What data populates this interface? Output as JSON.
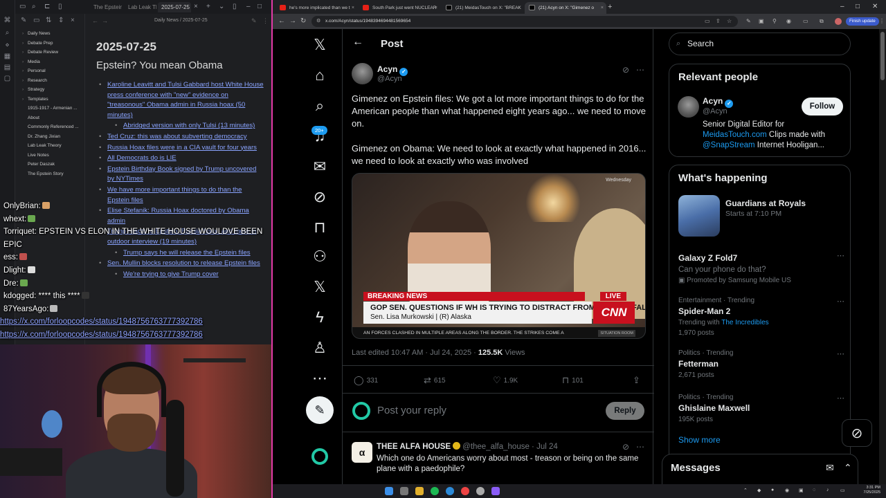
{
  "obsidian": {
    "tabs": [
      "The Epstein ...",
      "Lab Leak Th...",
      "2025-07-25"
    ],
    "breadcrumb": "Daily News  /  2025-07-25",
    "tree": [
      {
        "label": "Daily News",
        "top": true
      },
      {
        "label": "Debate Prep",
        "top": true
      },
      {
        "label": "Debate Review",
        "top": true
      },
      {
        "label": "Media",
        "top": true
      },
      {
        "label": "Personal",
        "top": true
      },
      {
        "label": "Research",
        "top": true
      },
      {
        "label": "Strategy",
        "top": true
      },
      {
        "label": "Templates",
        "top": true
      },
      {
        "label": "1915-1917 - Armenian ...",
        "top": false
      },
      {
        "label": "About",
        "top": false
      },
      {
        "label": "Commonly Referenced ...",
        "top": false
      },
      {
        "label": "Dr. Zhang Jixian",
        "top": false
      },
      {
        "label": "Lab Leak Theory",
        "top": false
      },
      {
        "label": "Live Notes",
        "top": false
      },
      {
        "label": "Peter Daszak",
        "top": false
      },
      {
        "label": "The Epstein Story",
        "top": false
      }
    ],
    "date_heading": "2025-07-25",
    "section_heading": "Epstein? You mean Obama",
    "notes": [
      {
        "text": "Karoline Leavitt and Tulsi Gabbard host White House press conference with \"new\" evidence on \"treasonous\" Obama admin in Russia hoax (50 minutes)",
        "level": 1
      },
      {
        "text": "Abridged version with only Tulsi (13 minutes)",
        "level": 2
      },
      {
        "text": "Ted Cruz: this was about subverting democracy",
        "level": 1
      },
      {
        "text": "Russia Hoax files were in a CIA vault for four years",
        "level": 1
      },
      {
        "text": "All Democrats do is LIE",
        "level": 1
      },
      {
        "text": "Epstein Birthday Book signed by Trump uncovered by NYTimes",
        "level": 1
      },
      {
        "text": "We have more important things to do than the Epstein files",
        "level": 1
      },
      {
        "text": "Elise Stefanik: Russia Hoax doctored by Obama admin",
        "level": 1
      },
      {
        "text": "Trump reacts to Epstein, Russia hoax, and more in outdoor interview (19 minutes)",
        "level": 1
      },
      {
        "text": "Trump says he will release the Epstein files",
        "level": 2
      },
      {
        "text": "Sen. Mullin blocks resolution to release Epstein files",
        "level": 1
      },
      {
        "text": "We're trying to give Trump cover",
        "level": 2
      }
    ]
  },
  "chat": [
    {
      "user": "OnlyBrian:",
      "text": "",
      "emote_color": "#d9a066"
    },
    {
      "user": "whext:",
      "text": "",
      "emote_color": "#6aa84f"
    },
    {
      "user": "Torriquet:",
      "text": "EPSTEIN VS ELON IN THE WHITE HOUSE WOULDVE BEEN",
      "emote_color": ""
    },
    {
      "user": "EPIC",
      "text": "",
      "emote_color": ""
    },
    {
      "user": "ess:",
      "text": "",
      "emote_color": "#c0504d"
    },
    {
      "user": "Dlight:",
      "text": "",
      "emote_color": "#dddddd"
    },
    {
      "user": "Dre:",
      "text": "",
      "emote_color": "#6aa84f"
    },
    {
      "user": "kdogged:",
      "text": "**** this ****",
      "emote_color": "#333333"
    },
    {
      "user": "87YearsAgo:",
      "text": "",
      "emote_color": "#bbbbbb"
    }
  ],
  "chat_urls": [
    "https://x.com/forloopcodes/status/1948756763777392786",
    "https://x.com/forloopcodes/status/1948756763777392786"
  ],
  "chrome": {
    "tabs": [
      {
        "title": "he's more implicated than we t",
        "color": "#e62117",
        "active": false
      },
      {
        "title": "South Park just went NUCLEAR",
        "color": "#e62117",
        "active": false
      },
      {
        "title": "(21) MeidasTouch on X: \"BREAK",
        "color": "#000000",
        "active": false
      },
      {
        "title": "(21) Acyn on X: \"Gimenez o",
        "color": "#000000",
        "active": true
      }
    ],
    "url": "x.com/Acyn/status/1948394694481569654",
    "finish_update": "Finish update"
  },
  "x": {
    "badge": "20+",
    "compose_icon": "feather-plus-icon",
    "post_title": "Post",
    "author_name": "Acyn",
    "author_handle": "@Acyn",
    "post_text_1": "Gimenez on Epstein files: We got a lot more important things to do for the American people than what happened eight years ago... we need to move on.",
    "post_text_2": "Gimenez on Obama: We need to look at exactly what happened in 2016... we need to look at exactly who was involved",
    "video": {
      "day": "Wednesday",
      "breaking": "BREAKING NEWS",
      "live": "LIVE",
      "headline": "GOP SEN. QUESTIONS IF WH IS TRYING TO DISTRACT FROM EPSTEIN FALLOUT",
      "subline": "Sen. Lisa Murkowski  |  (R) Alaska",
      "network": "CNN",
      "ticker": "AN FORCES CLASHED IN MULTIPLE AREAS ALONG THE BORDER. THE STRIKES COME A",
      "situation": "SITUATION ROOM"
    },
    "edited": "Last edited 10:47 AM · Jul 24, 2025 · ",
    "views_count": "125.5K",
    "views_label": " Views",
    "actions": {
      "replies": "331",
      "reposts": "615",
      "likes": "1.9K",
      "bookmarks": "101"
    },
    "reply_placeholder": "Post your reply",
    "reply_button": "Reply",
    "tweet2": {
      "name": "THEE ALFA HOUSE",
      "meta": "@thee_alfa_house · Jul 24",
      "avatar_text": "α",
      "text": "Which one do Americans worry about most - treason or being on the same plane with a paedophile?"
    },
    "search_placeholder": "Search",
    "relevant_title": "Relevant people",
    "rp": {
      "name": "Acyn",
      "handle": "@Acyn",
      "follow": "Follow",
      "bio_1": "Senior Digital Editor for ",
      "bio_link1": "MeidasTouch.com",
      "bio_2": " Clips made with ",
      "bio_link2": "@SnapStream",
      "bio_3": " Internet Hooligan..."
    },
    "happening_title": "What's happening",
    "game": {
      "title": "Guardians at Royals",
      "sub": "Starts at 7:10 PM"
    },
    "promo": {
      "name": "Galaxy Z Fold7",
      "sub": "Can your phone do that?",
      "promoted": "Promoted by Samsung Mobile US"
    },
    "trends": [
      {
        "context": "Entertainment · Trending",
        "name": "Spider-Man 2",
        "count_prefix": "Trending with ",
        "count_link": "The Incredibles",
        "count2": "1,970 posts"
      },
      {
        "context": "Politics · Trending",
        "name": "Fetterman",
        "count": "2,671 posts"
      },
      {
        "context": "Politics · Trending",
        "name": "Ghislaine Maxwell",
        "count": "195K posts"
      }
    ],
    "show_more": "Show more",
    "messages": "Messages"
  },
  "taskbar": {
    "time": "3:31 PM",
    "date": "7/25/2025"
  },
  "colors": {
    "accent": "#1d9bf0",
    "cnn_red": "#c8101e",
    "stream_border": "#e33aa7"
  }
}
